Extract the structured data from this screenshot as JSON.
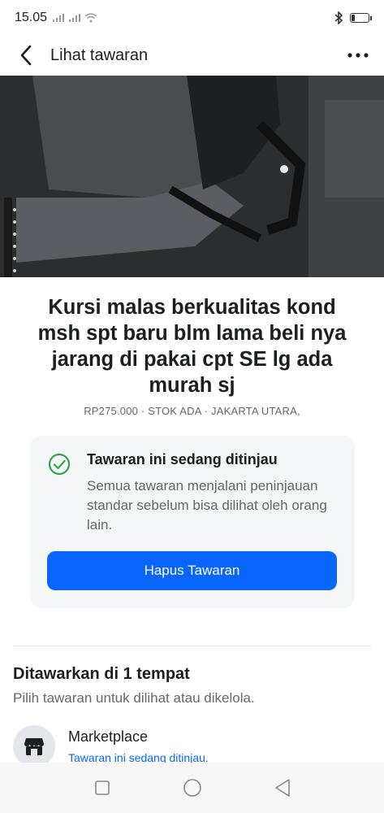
{
  "status_bar": {
    "time": "15.05",
    "signal_icons": [
      "sim1-signal-icon",
      "sim2-signal-icon",
      "wifi-icon"
    ],
    "right_icons": [
      "bluetooth-icon",
      "battery-icon"
    ],
    "battery_level": 0.2
  },
  "header": {
    "title": "Lihat tawaran",
    "back_icon": "chevron-left-icon",
    "more_icon": "more-dots-icon"
  },
  "photo": {
    "page_count": 10,
    "active_index": 0
  },
  "listing": {
    "title": "Kursi malas berkualitas kond msh spt baru blm lama beli nya jarang di pakai cpt SE lg ada murah sj",
    "meta": "RP275.000 · STOK ADA · JAKARTA UTARA,"
  },
  "review": {
    "icon": "check-circle-icon",
    "title": "Tawaran ini sedang ditinjau",
    "description": "Semua tawaran menjalani peninjauan standar sebelum bisa dilihat oleh orang lain.",
    "button_label": "Hapus Tawaran"
  },
  "offered": {
    "title": "Ditawarkan di 1 tempat",
    "subtitle": "Pilih tawaran untuk dilihat atau dikelola.",
    "places": [
      {
        "name": "Marketplace",
        "status": "Tawaran ini sedang ditinjau.",
        "icon": "marketplace-store-icon"
      }
    ]
  },
  "nav_bar": {
    "icons": [
      "recent-apps-icon",
      "home-icon",
      "back-triangle-icon"
    ]
  },
  "colors": {
    "accent": "#0866ff",
    "success": "#31a24c",
    "secondary_text": "#65676b"
  }
}
